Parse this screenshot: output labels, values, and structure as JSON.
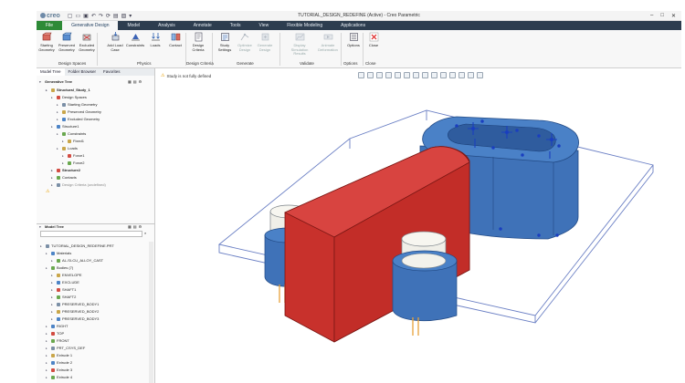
{
  "app": {
    "window_title": "TUTORIAL_DESIGN_REDEFINE (Active) - Creo Parametric",
    "logo_text": "creo"
  },
  "tabs": [
    "File",
    "Generative Design",
    "Model",
    "Analysis",
    "Annotate",
    "Tools",
    "View",
    "Flexible Modeling",
    "Applications"
  ],
  "ribbon": {
    "buttons": [
      {
        "label": "Starting Geometry",
        "disabled": false
      },
      {
        "label": "Preserved Geometry",
        "disabled": false
      },
      {
        "label": "Excluded Geometry",
        "disabled": false
      },
      {
        "label": "Add Load Case",
        "disabled": false
      },
      {
        "label": "Constraints",
        "disabled": false
      },
      {
        "label": "Loads",
        "disabled": false
      },
      {
        "label": "Contact",
        "disabled": false
      },
      {
        "label": "Design Criteria",
        "disabled": false
      },
      {
        "label": "Study Settings",
        "disabled": false
      },
      {
        "label": "Optimize Design",
        "disabled": true
      },
      {
        "label": "Generate Design",
        "disabled": true
      },
      {
        "label": "Display Simulation Results",
        "disabled": true
      },
      {
        "label": "Animate Deformation",
        "disabled": true
      },
      {
        "label": "Options",
        "disabled": false
      },
      {
        "label": "Close",
        "disabled": false
      }
    ],
    "groups": [
      "Design Spaces",
      "Physics",
      "Design Criteria",
      "Generate",
      "Validate",
      "Options",
      "Close"
    ]
  },
  "panel": {
    "tabs": [
      "Model Tree",
      "Folder Browser",
      "Favorites"
    ],
    "gen_tree_title": "Generative Tree",
    "gen_tree": [
      {
        "label": "Structural_Study_1",
        "level": 1,
        "bold": true
      },
      {
        "label": "Design Spaces",
        "level": 2
      },
      {
        "label": "Starting Geometry",
        "level": 3
      },
      {
        "label": "Preserved Geometry",
        "level": 3
      },
      {
        "label": "Excluded Geometry",
        "level": 3
      },
      {
        "label": "Structure1",
        "level": 2
      },
      {
        "label": "Constraints",
        "level": 3
      },
      {
        "label": "Fixed1",
        "level": 4
      },
      {
        "label": "Loads",
        "level": 3
      },
      {
        "label": "Force1",
        "level": 4
      },
      {
        "label": "Force2",
        "level": 4
      },
      {
        "label": "Structure2",
        "level": 2,
        "bold": true
      },
      {
        "label": "Contacts",
        "level": 2
      },
      {
        "label": "Design Criteria (undefined)",
        "level": 2,
        "grey": true
      }
    ],
    "model_tree_title": "Model Tree",
    "model_tree": [
      {
        "label": "TUTORIAL_DESIGN_REDEFINE.PRT",
        "level": 0
      },
      {
        "label": "Materials",
        "level": 1
      },
      {
        "label": "AL-SI-CU_ALLOY_CAST",
        "level": 2
      },
      {
        "label": "Bodies (7)",
        "level": 1
      },
      {
        "label": "ENVELOPE",
        "level": 2
      },
      {
        "label": "EXCLUDE",
        "level": 2
      },
      {
        "label": "SHAFT1",
        "level": 2
      },
      {
        "label": "SHAFT2",
        "level": 2
      },
      {
        "label": "PRESERVED_BODY1",
        "level": 2
      },
      {
        "label": "PRESERVED_BODY2",
        "level": 2
      },
      {
        "label": "PRESERVED_BODY3",
        "level": 2
      },
      {
        "label": "RIGHT",
        "level": 1
      },
      {
        "label": "TOP",
        "level": 1
      },
      {
        "label": "FRONT",
        "level": 1
      },
      {
        "label": "PRT_CSYS_DEF",
        "level": 1
      },
      {
        "label": "Extrude 1",
        "level": 1
      },
      {
        "label": "Extrude 2",
        "level": 1
      },
      {
        "label": "Extrude 3",
        "level": 1
      },
      {
        "label": "Extrude 4",
        "level": 1
      }
    ]
  },
  "graphics": {
    "status": "Study is not fully defined"
  },
  "colors": {
    "tab_bar": "#2d3d4f",
    "file_tab": "#2e8a37",
    "preserved_blue": "#3f72b8",
    "starting_red": "#c8312c",
    "envelope_line": "#6a7fc4",
    "warning": "#e8a000"
  }
}
